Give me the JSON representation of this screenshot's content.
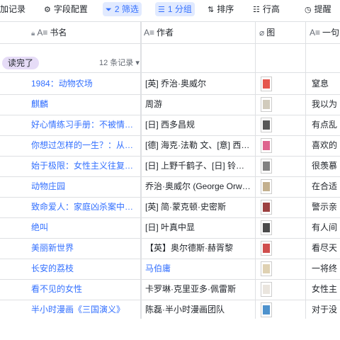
{
  "toolbar": {
    "add_record": "加记录",
    "field_config": "字段配置",
    "filter": "2 筛选",
    "group": "1 分组",
    "sort": "排序",
    "row_height": "行高",
    "remind": "提醒"
  },
  "columns": {
    "title": "书名",
    "author": "作者",
    "image": "图",
    "quote": "一句"
  },
  "group": {
    "label": "读完了",
    "count": "12 条记录"
  },
  "rows": [
    {
      "title": "1984：动物农场",
      "author": "[英] 乔治·奥威尔",
      "quote": "窒息",
      "cover": "#e03a2f"
    },
    {
      "title": "麒麟",
      "author": "周游",
      "quote": "我以为",
      "cover": "#c9c2b0"
    },
    {
      "title": "好心情练习手册：不被情绪左右的活法",
      "author": "[日] 西多昌规",
      "quote": "有点乱",
      "cover": "#3a3a3a"
    },
    {
      "title": "你想过怎样的一生？：从当下开始的人生设计",
      "author": "[德] 海克·法勒 文、[意] 西尔维",
      "quote": "喜欢的",
      "cover": "#d84a7a"
    },
    {
      "title": "始于极限：女性主义往复书简",
      "author": "[日] 上野千鹤子、[日] 铃木凉美",
      "quote": "很羡慕",
      "cover": "#6b6b6b"
    },
    {
      "title": "动物庄园",
      "author": "乔治·奥威尔 (George Orwell)",
      "quote": "在合适",
      "cover": "#b8a27a"
    },
    {
      "title": "致命爱人：家庭凶杀案中的人性之光",
      "author": "[英] 简·蒙克顿·史密斯",
      "quote": "警示亲",
      "cover": "#8b1e1e"
    },
    {
      "title": "绝叫",
      "author": "[日] 叶真中显",
      "quote": "有人间",
      "cover": "#2b2b2b"
    },
    {
      "title": "美丽新世界",
      "author": "【英】奥尔德斯·赫胥黎",
      "quote": "看尽天",
      "cover": "#c8302f"
    },
    {
      "title": "长安的荔枝",
      "author": "马伯庸",
      "quote": "一将终",
      "cover": "#d9c9a5",
      "author_link": true
    },
    {
      "title": "看不见的女性",
      "author": "卡罗琳·克里亚多·佩雷斯",
      "quote": "女性主",
      "cover": "#e6e1d8"
    },
    {
      "title": "半小时漫画《三国演义》",
      "author": "陈磊·半小时漫画团队",
      "quote": "对于没",
      "cover": "#2f7fc4"
    }
  ]
}
